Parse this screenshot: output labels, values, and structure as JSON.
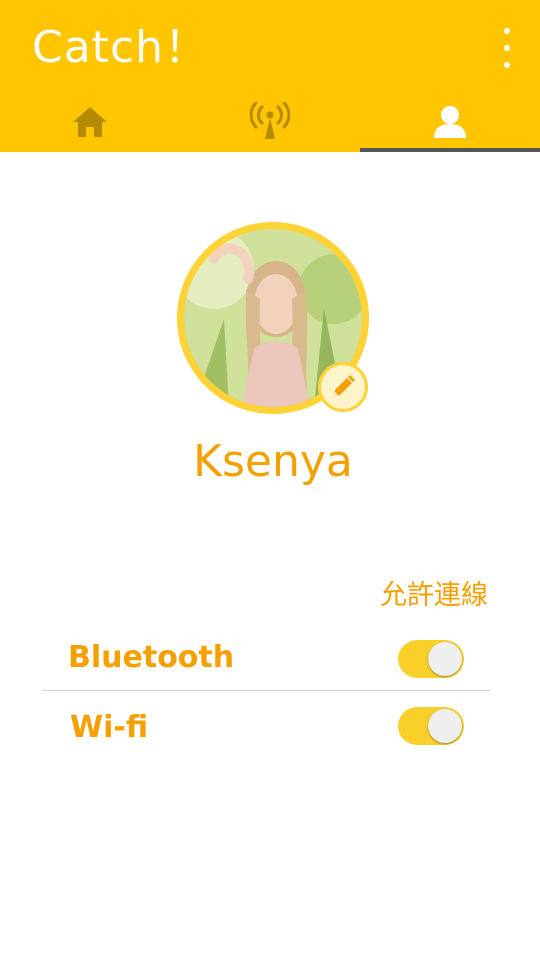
{
  "header": {
    "title": "Catch！",
    "menu_icon": "more-vert-icon",
    "tabs": [
      {
        "icon": "home-icon",
        "selected": false
      },
      {
        "icon": "antenna-icon",
        "selected": false
      },
      {
        "icon": "person-icon",
        "selected": true
      }
    ]
  },
  "profile": {
    "name": "Ksenya",
    "avatar_icon": "profile-photo",
    "edit_icon": "pencil-icon"
  },
  "connections": {
    "allow_label": "允許連線",
    "items": [
      {
        "label": "Bluetooth",
        "enabled": true
      },
      {
        "label": "Wi-fi",
        "enabled": true
      }
    ]
  },
  "colors": {
    "accent": "#FFC500",
    "text_accent": "#F5A000",
    "toggle_on": "#F9CF2A",
    "tab_inactive": "#B58A00",
    "tab_indicator": "#555555"
  }
}
